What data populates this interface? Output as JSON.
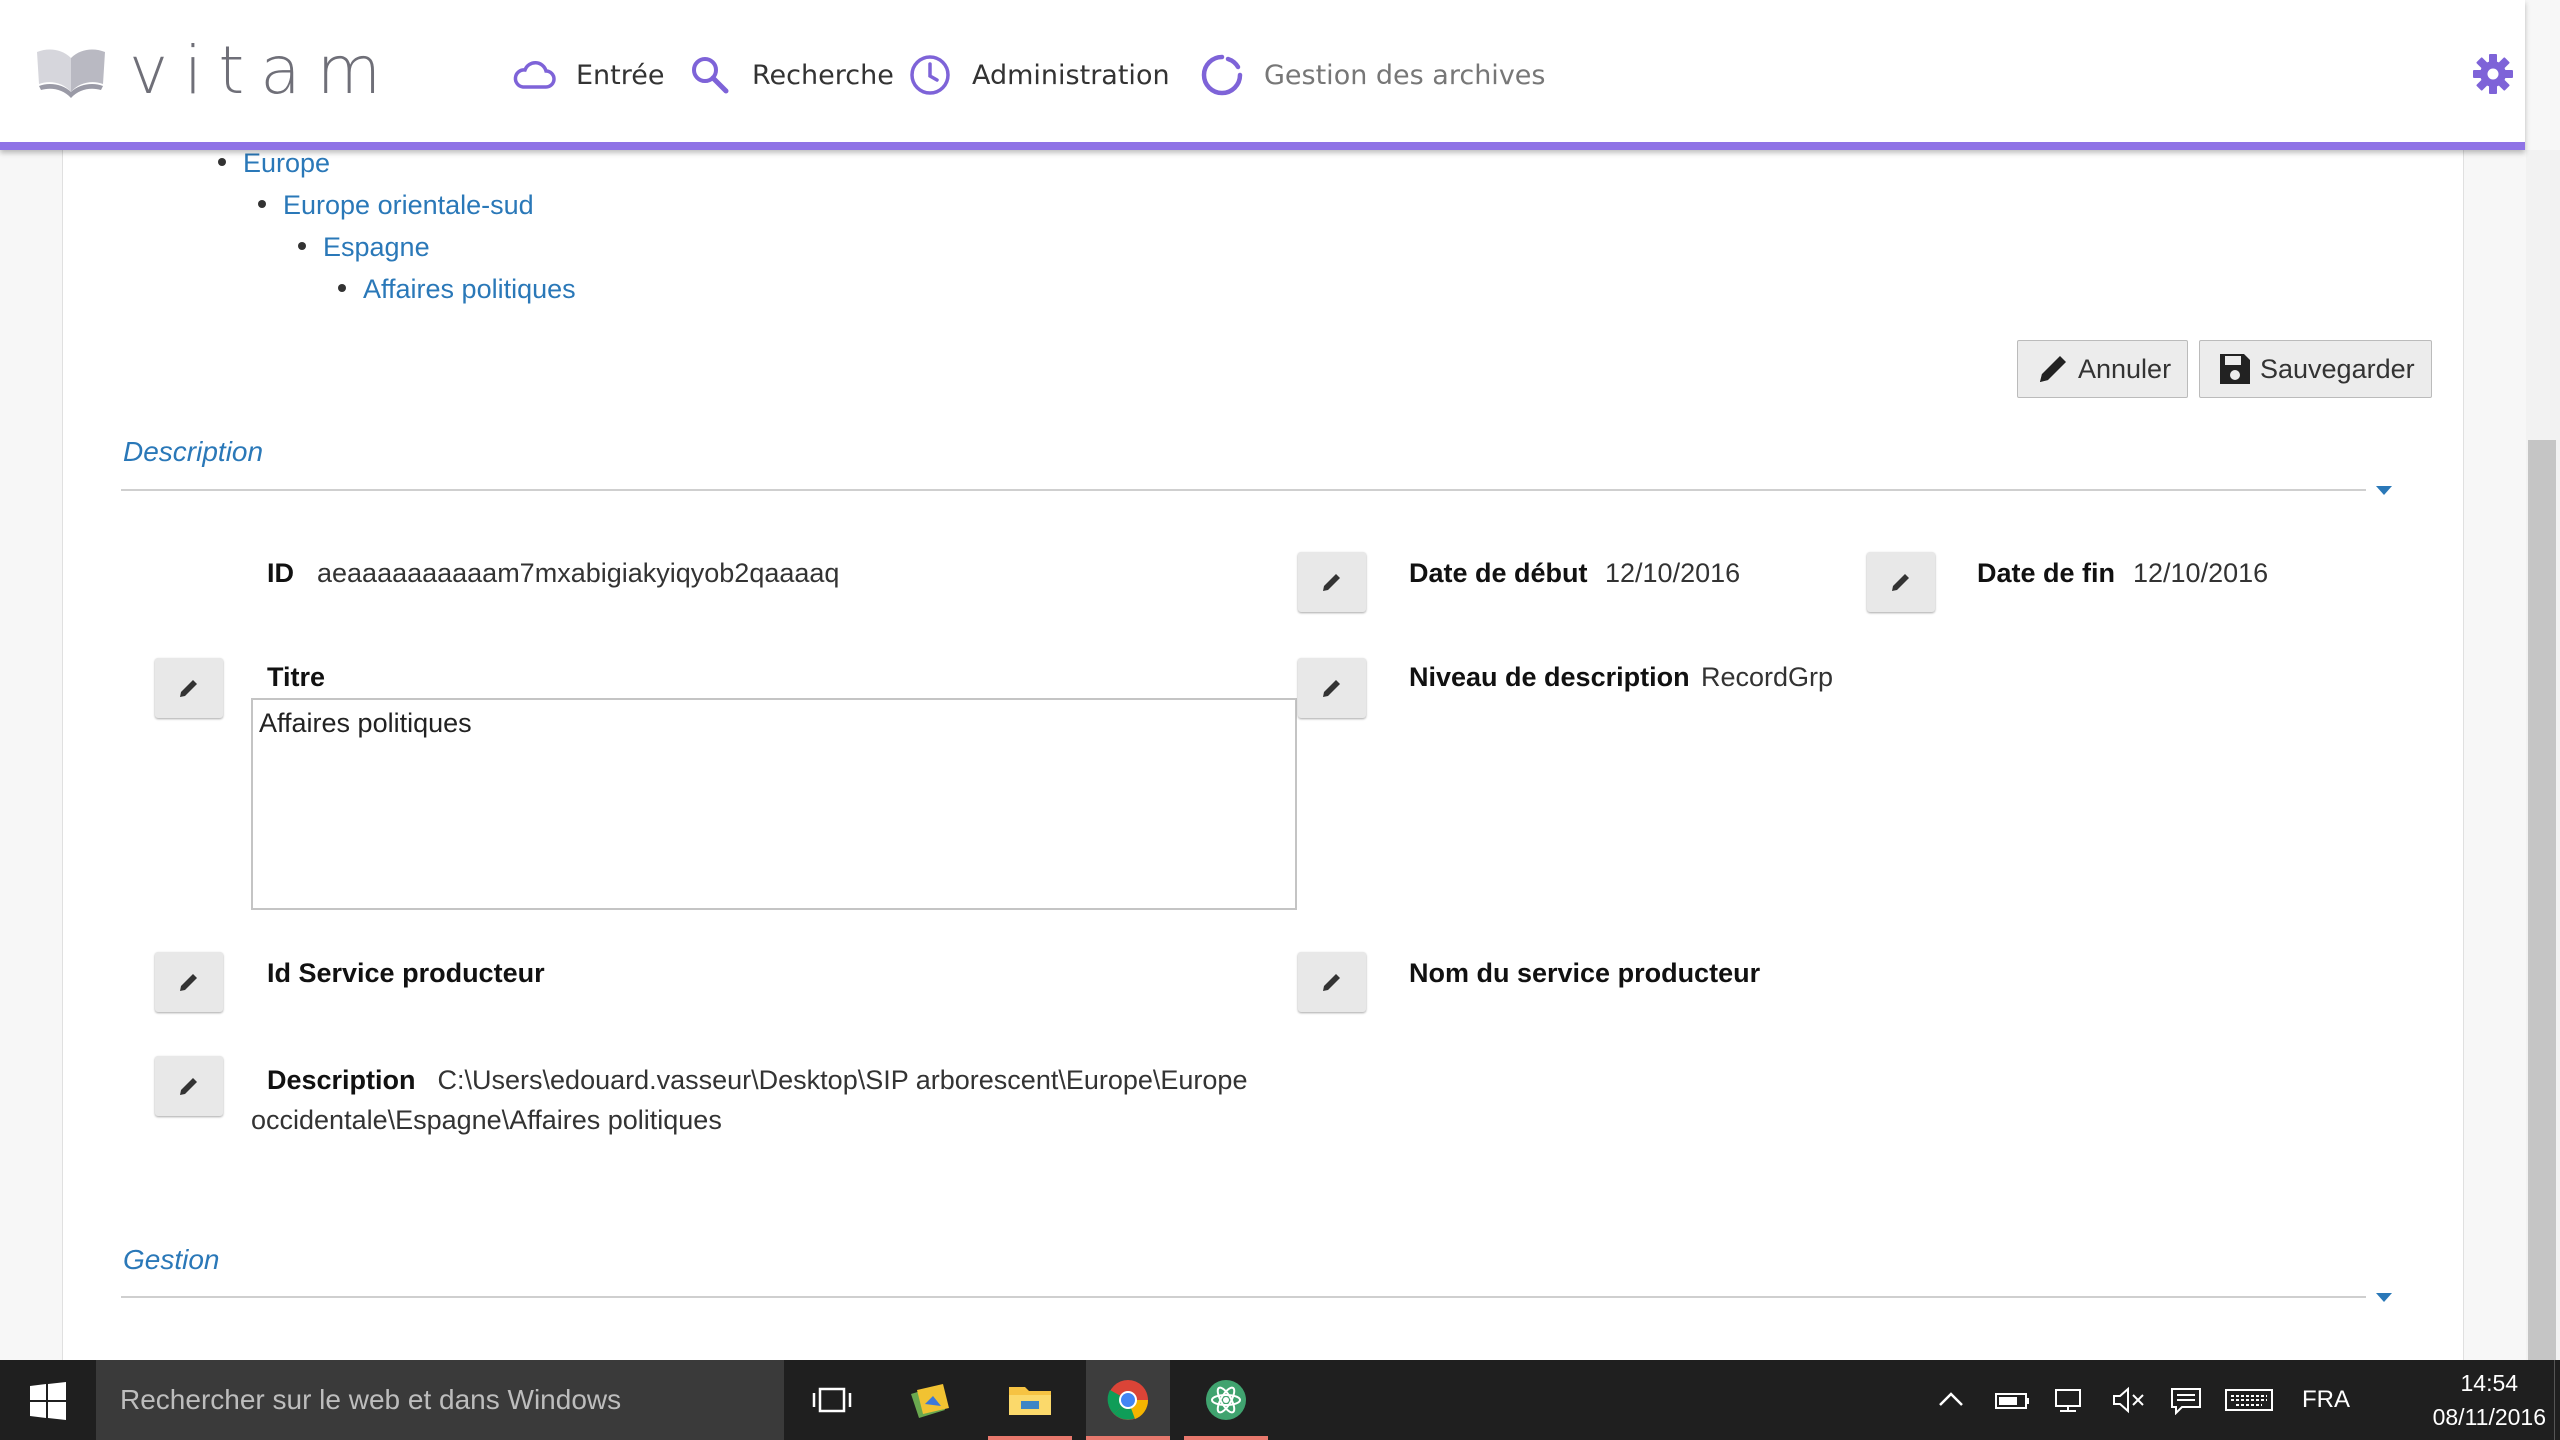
{
  "app": {
    "logo_text": "vitam",
    "colors": {
      "accent": "#8f73e6",
      "link": "#2a78b8"
    }
  },
  "nav": [
    {
      "label": "Entrée",
      "icon": "cloud-icon"
    },
    {
      "label": "Recherche",
      "icon": "search-icon"
    },
    {
      "label": "Administration",
      "icon": "clock-icon"
    },
    {
      "label": "Gestion des archives",
      "icon": "spinner-icon"
    }
  ],
  "settings_icon": "gear-icon",
  "tree": [
    "Europe",
    "Europe orientale-sud",
    "Espagne",
    "Affaires politiques"
  ],
  "actions": {
    "cancel_label": "Annuler",
    "save_label": "Sauvegarder"
  },
  "sections": {
    "description": "Description",
    "gestion": "Gestion"
  },
  "fields": {
    "id": {
      "label": "ID",
      "value": "aeaaaaaaaaaam7mxabigiakyiqyob2qaaaaq"
    },
    "start_date": {
      "label": "Date de début",
      "value": "12/10/2016"
    },
    "end_date": {
      "label": "Date de fin",
      "value": "12/10/2016"
    },
    "title": {
      "label": "Titre",
      "value": "Affaires politiques"
    },
    "level": {
      "label": "Niveau de description",
      "value": "RecordGrp"
    },
    "producer_id": {
      "label": "Id Service producteur"
    },
    "producer_name": {
      "label": "Nom du service producteur"
    },
    "description": {
      "label": "Description",
      "value": "C:\\Users\\edouard.vasseur\\Desktop\\SIP arborescent\\Europe\\Europe occidentale\\Espagne\\Affaires politiques"
    }
  },
  "taskbar": {
    "search_placeholder": "Rechercher sur le web et dans Windows",
    "apps": [
      "task-view-icon",
      "photos-icon",
      "file-explorer-icon",
      "chrome-icon",
      "atom-icon"
    ],
    "language": "FRA",
    "time": "14:54",
    "date": "08/11/2016"
  }
}
